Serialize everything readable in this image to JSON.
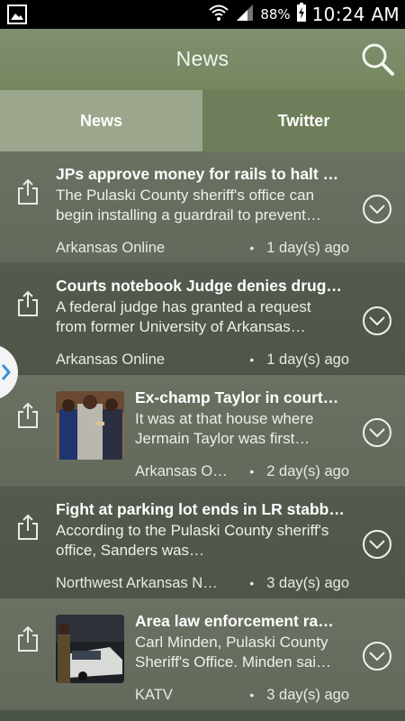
{
  "status": {
    "battery": "88%",
    "time": "10:24 AM"
  },
  "header": {
    "title": "News"
  },
  "tabs": [
    {
      "label": "News"
    },
    {
      "label": "Twitter"
    }
  ],
  "items": [
    {
      "headline": "JPs approve money for rails to halt 2…",
      "summary": "The Pulaski County sheriff's office can begin installing a guardrail to prevent…",
      "source": "Arkansas Online",
      "time": "1 day(s) ago"
    },
    {
      "headline": "Courts notebook Judge denies drug…",
      "summary": "A federal judge has granted a request from former University of Arkansas…",
      "source": "Arkansas Online",
      "time": "1 day(s) ago"
    },
    {
      "headline": "Ex-champ Taylor in court…",
      "summary": "It was at that house where Jermain Taylor was first…",
      "source": "Arkansas O…",
      "time": "2 day(s) ago"
    },
    {
      "headline": "Fight at parking lot ends in LR stabbi…",
      "summary": "According to the Pulaski County sheriff's office, Sanders was…",
      "source": "Northwest Arkansas N…",
      "time": "3 day(s) ago"
    },
    {
      "headline": "Area law enforcement ram…",
      "summary": "Carl Minden, Pulaski County Sheriff's Office. Minden sai…",
      "source": "KATV",
      "time": "3 day(s) ago"
    }
  ],
  "icons": {
    "gallery": "gallery-icon",
    "wifi": "wifi-icon",
    "signal": "signal-icon",
    "battery": "battery-icon",
    "search": "search-icon",
    "share": "share-icon",
    "expand": "chevron-down-circle-icon",
    "handle": "chevron-right-icon"
  },
  "colors": {
    "action_bar": "#7a8a67",
    "tab_active": "#9ba68c",
    "tab_inactive": "#6f7e5a"
  }
}
